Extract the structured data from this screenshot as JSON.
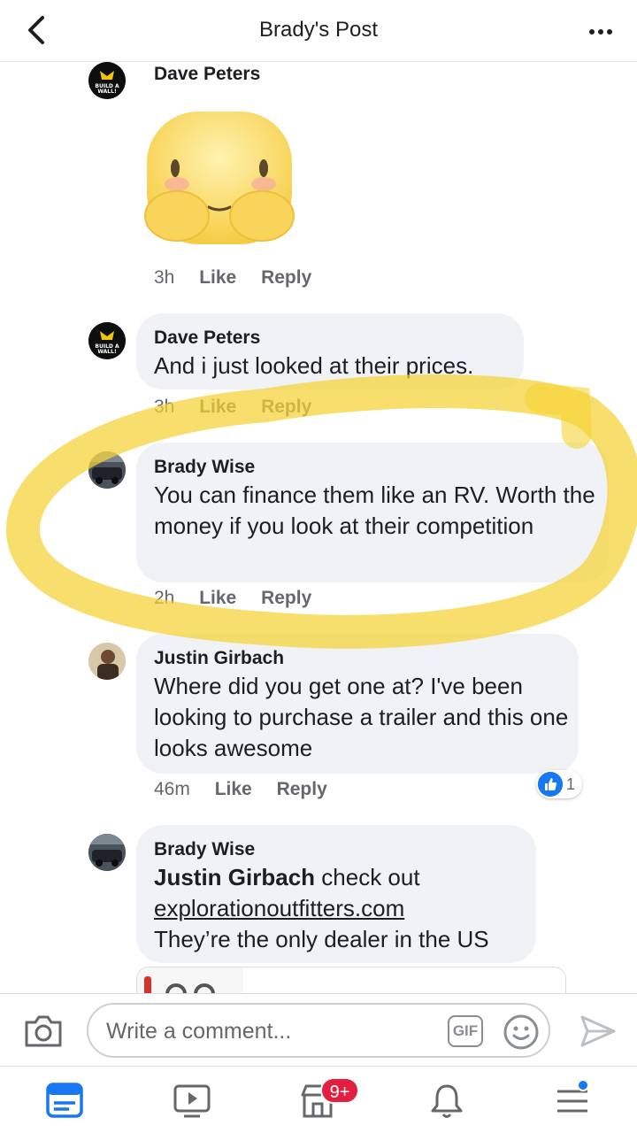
{
  "header": {
    "title": "Brady's Post"
  },
  "comments": [
    {
      "author": "Dave Peters",
      "text": "",
      "time": "3h",
      "like": "Like",
      "reply": "Reply"
    },
    {
      "author": "Dave Peters",
      "text": "And i just looked at their prices.",
      "time": "3h",
      "like": "Like",
      "reply": "Reply"
    },
    {
      "author": "Brady Wise",
      "text": "You can finance them like an RV. Worth the money if you look at their competition",
      "time": "2h",
      "like": "Like",
      "reply": "Reply"
    },
    {
      "author": "Justin Girbach",
      "text": "Where did you get one at? I've been looking to purchase a trailer and this one looks awesome",
      "time": "46m",
      "like": "Like",
      "reply": "Reply",
      "reactions": "1"
    },
    {
      "author": "Brady Wise",
      "mention": "Justin Girbach",
      "text_after_mention": " check out",
      "link": "explorationoutfitters.com",
      "text_last": "They’re the only dealer in the US"
    }
  ],
  "avatar_badge_text": "BUILD A WALL!",
  "composer": {
    "placeholder": "Write a comment...",
    "gif_label": "GIF"
  },
  "tabbar": {
    "notifications_badge": "9+"
  },
  "colors": {
    "highlight": "#f5d334",
    "accent": "#1877f2",
    "badge": "#e41e3f"
  }
}
